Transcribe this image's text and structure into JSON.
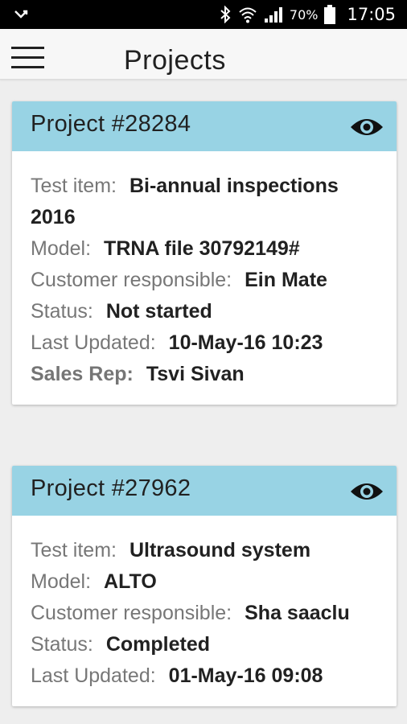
{
  "status_bar": {
    "notification_icon": "check-arrow-icon",
    "icons": [
      "bluetooth-icon",
      "wifi-icon",
      "signal-icon",
      "battery-icon"
    ],
    "battery_percent": "70%",
    "time": "17:05"
  },
  "app_bar": {
    "menu_icon": "hamburger-menu-icon",
    "title": "Projects"
  },
  "colors": {
    "card_header": "#98d3e4",
    "label_text": "#777777",
    "value_text": "#212121"
  },
  "projects": [
    {
      "title": "Project #28284",
      "view_icon": "eye-icon",
      "test_item_label": "Test item:",
      "test_item": "Bi-annual inspections 2016",
      "model_label": "Model:",
      "model": "TRNA file 30792149#",
      "customer_label": "Customer responsible:",
      "customer": "Ein Mate",
      "status_label": "Status:",
      "status": "Not started",
      "updated_label": "Last Updated:",
      "updated": "10-May-16 10:23",
      "sales_rep_label": "Sales Rep:",
      "sales_rep": "Tsvi Sivan"
    },
    {
      "title": "Project #27962",
      "view_icon": "eye-icon",
      "test_item_label": "Test item:",
      "test_item": "Ultrasound system",
      "model_label": "Model:",
      "model": "ALTO",
      "customer_label": "Customer responsible:",
      "customer": "Sha saaclu",
      "status_label": "Status:",
      "status": "Completed",
      "updated_label": "Last Updated:",
      "updated": "01-May-16 09:08"
    }
  ]
}
